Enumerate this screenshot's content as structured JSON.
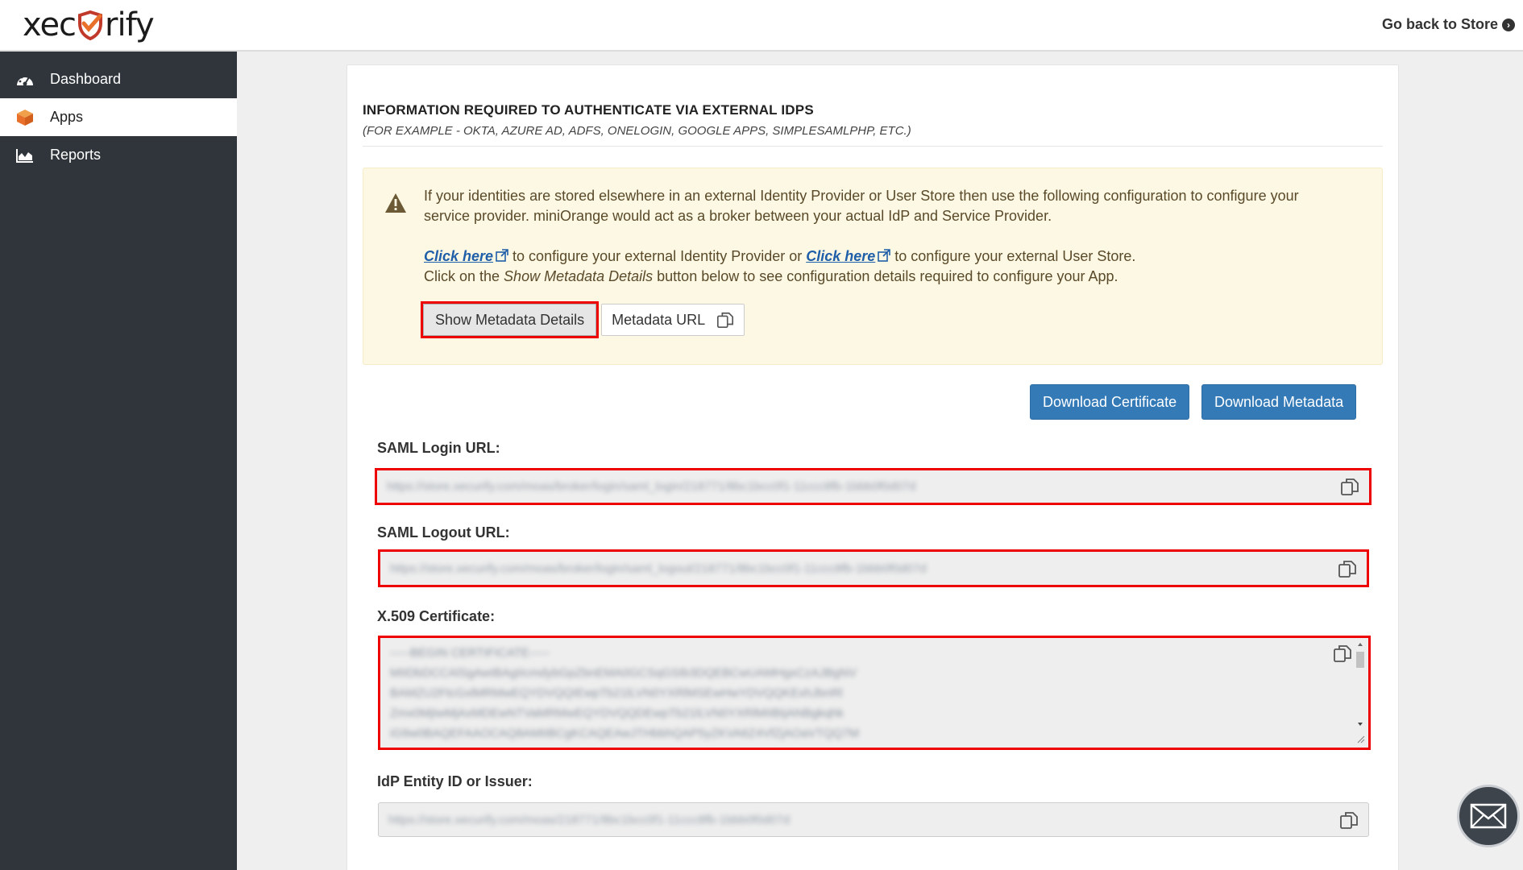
{
  "header": {
    "logo_left": "xec",
    "logo_right": "rify",
    "back_link": "Go back to Store"
  },
  "sidebar": {
    "items": [
      {
        "label": "Dashboard",
        "icon": "dashboard-icon",
        "active": false
      },
      {
        "label": "Apps",
        "icon": "cube-icon",
        "active": true
      },
      {
        "label": "Reports",
        "icon": "area-chart-icon",
        "active": false
      }
    ]
  },
  "panel": {
    "heading": "INFORMATION REQUIRED TO AUTHENTICATE VIA EXTERNAL IDPS",
    "subheading": "(FOR EXAMPLE - OKTA, AZURE AD, ADFS, ONELOGIN, GOOGLE APPS, SIMPLESAMLPHP, ETC.)"
  },
  "alert": {
    "intro": "If your identities are stored elsewhere in an external Identity Provider or User Store then use the following configuration to configure your service provider. miniOrange would act as a broker between your actual IdP and Service Provider.",
    "link1": "Click here",
    "mid1": " to configure your external Identity Provider or ",
    "link2": "Click here",
    "mid2": " to configure your external User Store.",
    "line3_pre": "Click on the ",
    "line3_em": "Show Metadata Details",
    "line3_post": " button below to see configuration details required to configure your App.",
    "show_metadata_button": "Show Metadata Details",
    "metadata_url_button": "Metadata URL"
  },
  "actions": {
    "download_certificate": "Download Certificate",
    "download_metadata": "Download Metadata"
  },
  "fields": {
    "saml_login_label": "SAML Login URL:",
    "saml_login_value": "https://store.xecurify.com/moas/broker/login/saml_login/218771/8bc1bcc0f1-11ccc8fb-1bbb0f0d07d",
    "saml_logout_label": "SAML Logout URL:",
    "saml_logout_value": "https://store.xecurify.com/moas/broker/login/saml_logout/218771/8bc1bcc0f1-11ccc8fb-1bbb0f0d07d",
    "cert_label": "X.509 Certificate:",
    "cert_value": "-----BEGIN CERTIFICATE-----\nMIIDbDCCAlSgAwIBAgIIcmdybGpZbnEMA0GCSqGSIb3DQEBCwUAMHgxCzAJBgNV\nBAMZU2FtcGxlMRMwEQYDVQQIEwpTb21lLVN0YXRlMSEwHwYDVQQKExhJbnRl\nZmx0MjIwMjAxMDEwNTVaMRMwEQYDVQQDEwpTb21lLVN0YXRlMIIBIjANBgkqhk\niG9w0BAQEFAAOCAQ8AMIIBCgKCAQEAwJTHbbhQAP5yZKVA6Z4VfZjAOaVTQQ7M",
    "idp_entity_label": "IdP Entity ID or Issuer:",
    "idp_entity_value": "https://store.xecurify.com/moas/218771/8bc1bcc0f1-11ccc8fb-1bbb0f0d07d"
  },
  "colors": {
    "sidebar_bg": "#2f353b",
    "primary": "#337ab7",
    "alert_bg": "#fcf8e3",
    "highlight": "#e00000",
    "brand_orange": "#e8702a"
  }
}
